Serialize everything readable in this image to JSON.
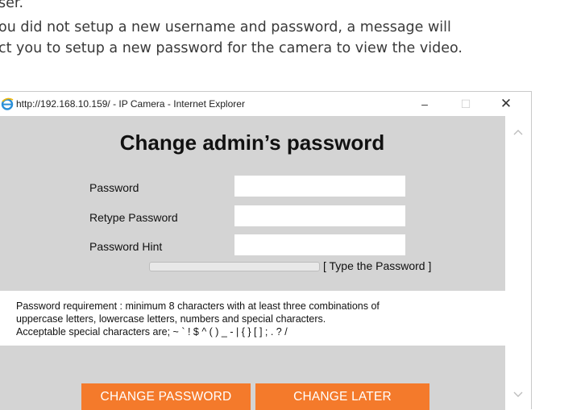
{
  "document": {
    "line1": "ser.",
    "line2": "ou did not setup a new username and password, a message will",
    "line3": "ct you to setup a new password for the camera to view the video."
  },
  "window": {
    "title": "http://192.168.10.159/ - IP Camera - Internet Explorer",
    "minimize_glyph": "–",
    "maximize_glyph": "☐",
    "close_glyph": "✕"
  },
  "form": {
    "heading": "Change admin’s password",
    "password_label": "Password",
    "retype_label": "Retype Password",
    "hint_label": "Password Hint",
    "password_value": "",
    "retype_value": "",
    "hint_value": "",
    "strength_text": "[ Type the Password ]"
  },
  "requirements": {
    "line1": "Password requirement : minimum 8 characters with at least three combinations of",
    "line2": "uppercase letters, lowercase letters, numbers and special characters.",
    "line3": "Acceptable special characters are; ~ ` ! $ ^ ( ) _ - | { } [ ] ; . ? /"
  },
  "buttons": {
    "change_password": "CHANGE PASSWORD",
    "change_later": "CHANGE LATER"
  },
  "colors": {
    "button_bg": "#f47a2b",
    "content_bg": "#d4d4d4"
  },
  "icons": {
    "browser": "internet-explorer-icon",
    "scroll_up": "chevron-up-icon",
    "scroll_down": "chevron-down-icon"
  }
}
